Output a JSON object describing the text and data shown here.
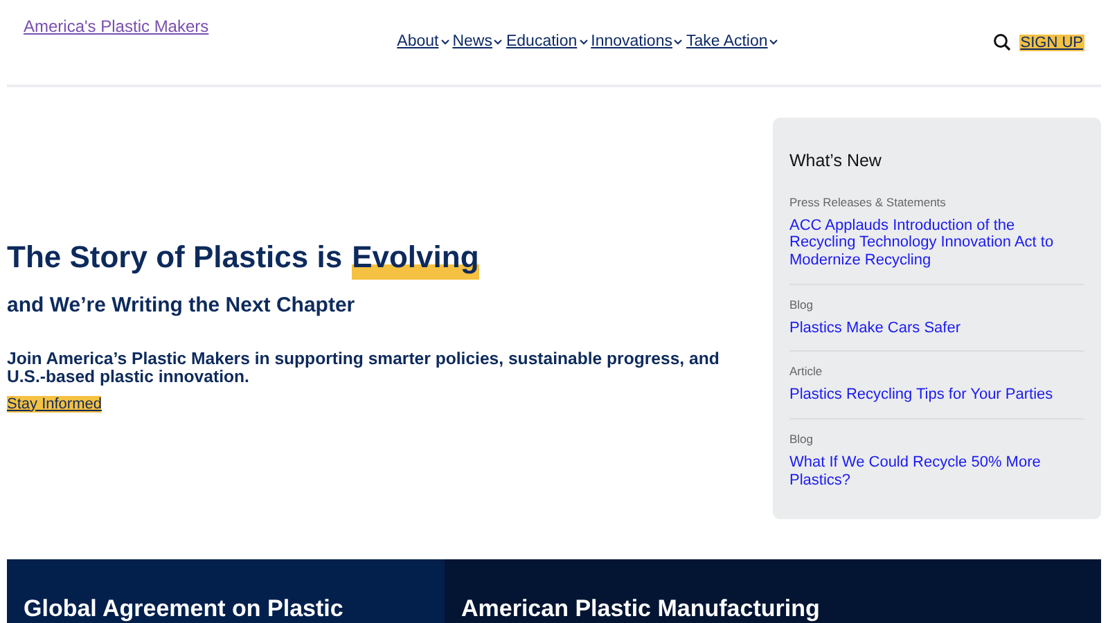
{
  "header": {
    "logo": "America's Plastic Makers",
    "nav": [
      {
        "label": "About",
        "dropdown": true
      },
      {
        "label": "News",
        "dropdown": true
      },
      {
        "label": "Education",
        "dropdown": true
      },
      {
        "label": "Innovations",
        "dropdown": true
      },
      {
        "label": "Take Action",
        "dropdown": true
      }
    ],
    "signup": "SIGN UP"
  },
  "hero": {
    "title": "The Story of Plastics is",
    "highlight": "Evolving",
    "subtitle": "and We’re Writing the Next Chapter",
    "body": "Join America’s Plastic Makers in supporting smarter policies, sustainable progress, and U.S.-based plastic innovation.",
    "link": "Stay Informed"
  },
  "whats_new": {
    "title": "What’s New",
    "items": [
      {
        "category": "Press Releases & Statements",
        "headline": "ACC Applauds Introduction of the Recycling Technology Innovation Act to Modernize Recycling"
      },
      {
        "category": "Blog",
        "headline": "Plastics Make Cars Safer"
      },
      {
        "category": "Article",
        "headline": "Plastics Recycling Tips for Your Parties"
      },
      {
        "category": "Blog",
        "headline": "What If We Could Recycle 50% More Plastics?"
      }
    ]
  },
  "cards": [
    {
      "title": "Global Agreement on Plastic"
    },
    {
      "title": "American Plastic Manufacturing"
    }
  ]
}
